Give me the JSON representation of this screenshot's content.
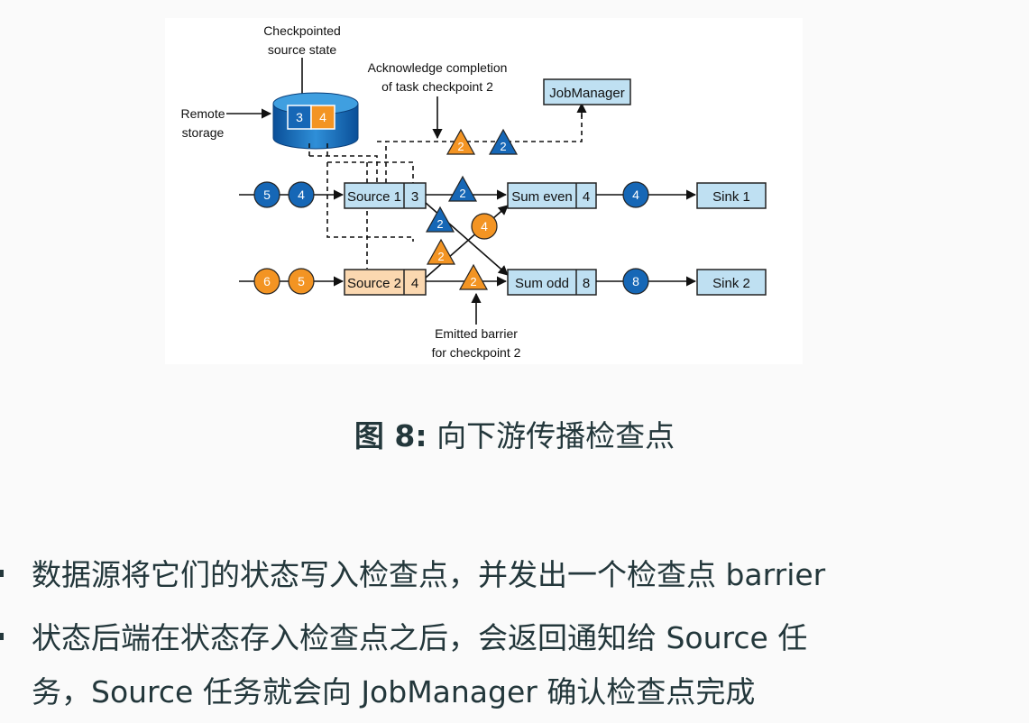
{
  "figure": {
    "callouts": {
      "checkpointed_line1": "Checkpointed",
      "checkpointed_line2": "source state",
      "ack_line1": "Acknowledge completion",
      "ack_line2": "of task checkpoint 2",
      "remote_line1": "Remote",
      "remote_line2": "storage",
      "emitted_line1": "Emitted barrier",
      "emitted_line2": "for checkpoint 2"
    },
    "jobmanager": "JobManager",
    "storage_values": [
      "3",
      "4"
    ],
    "source1": {
      "label": "Source 1",
      "state": "3"
    },
    "source2": {
      "label": "Source 2",
      "state": "4"
    },
    "sum_even": {
      "label": "Sum even",
      "state": "4"
    },
    "sum_odd": {
      "label": "Sum odd",
      "state": "8"
    },
    "sink1": "Sink 1",
    "sink2": "Sink 2",
    "stream1_records": [
      "5",
      "4"
    ],
    "stream2_records": [
      "6",
      "5"
    ],
    "out_even_record": "4",
    "out_odd_record": "8",
    "cross_record": "4",
    "barrier_label": "2",
    "colors": {
      "blue": "#1667b6",
      "orange": "#f39423",
      "box_blue": "#bfe0f2",
      "box_orange": "#fbd8b0"
    }
  },
  "caption": {
    "prefix": "图 8:",
    "text": "向下游传播检查点"
  },
  "bullets": [
    {
      "line1": "数据源将它们的状态写入检查点，并发出一个检查点 barrier"
    },
    {
      "line1": "状态后端在状态存入检查点之后，会返回通知给 Source 任",
      "line2": "务，Source 任务就会向 JobManager 确认检查点完成"
    }
  ]
}
